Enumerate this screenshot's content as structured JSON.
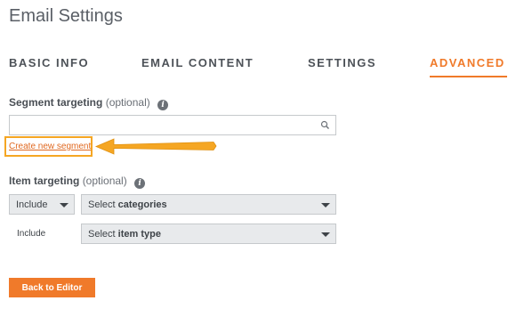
{
  "page": {
    "title": "Email Settings"
  },
  "tabs": [
    {
      "label": "BASIC INFO",
      "active": false
    },
    {
      "label": "EMAIL CONTENT",
      "active": false
    },
    {
      "label": "SETTINGS",
      "active": false
    },
    {
      "label": "ADVANCED",
      "active": true
    }
  ],
  "segment_targeting": {
    "label": "Segment targeting",
    "optional": "(optional)",
    "search_value": "",
    "create_link": "Create new segment"
  },
  "item_targeting": {
    "label": "Item targeting",
    "optional": "(optional)",
    "row1": {
      "include_value": "Include",
      "select_prefix": "Select ",
      "select_emph": "categories"
    },
    "row2": {
      "include_text": "Include",
      "select_prefix": "Select ",
      "select_emph": "item type"
    }
  },
  "actions": {
    "back_label": "Back to Editor"
  },
  "colors": {
    "accent": "#f07a2a",
    "highlight": "#f5a623"
  }
}
